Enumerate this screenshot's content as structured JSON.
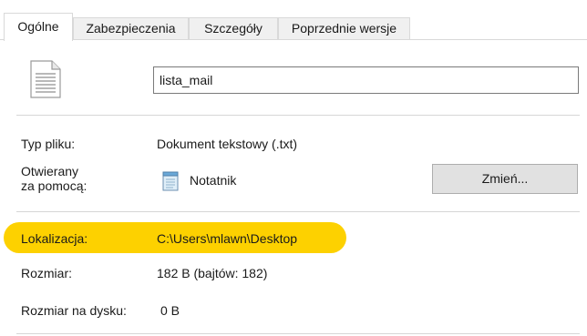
{
  "tabs": [
    {
      "label": "Ogólne",
      "active": true
    },
    {
      "label": "Zabezpieczenia",
      "active": false
    },
    {
      "label": "Szczegóły",
      "active": false
    },
    {
      "label": "Poprzednie wersje",
      "active": false
    }
  ],
  "file": {
    "icon": "text-file-icon",
    "name": "lista_mail"
  },
  "properties": {
    "type_label": "Typ pliku:",
    "type_value": "Dokument tekstowy (.txt)",
    "opens_with_label_line1": "Otwierany",
    "opens_with_label_line2": "za pomocą:",
    "opens_with_icon": "notepad-icon",
    "opens_with_value": "Notatnik",
    "change_button": "Zmień...",
    "location_label": "Lokalizacja:",
    "location_value": "C:\\Users\\mlawn\\Desktop",
    "size_label": "Rozmiar:",
    "size_value": "182 B (bajtów: 182)",
    "size_on_disk_label": "Rozmiar na dysku:",
    "size_on_disk_value": "0 B"
  },
  "colors": {
    "highlight": "#fdd100",
    "tab_inactive_bg": "#f0f0f0",
    "button_bg": "#e1e1e1"
  }
}
